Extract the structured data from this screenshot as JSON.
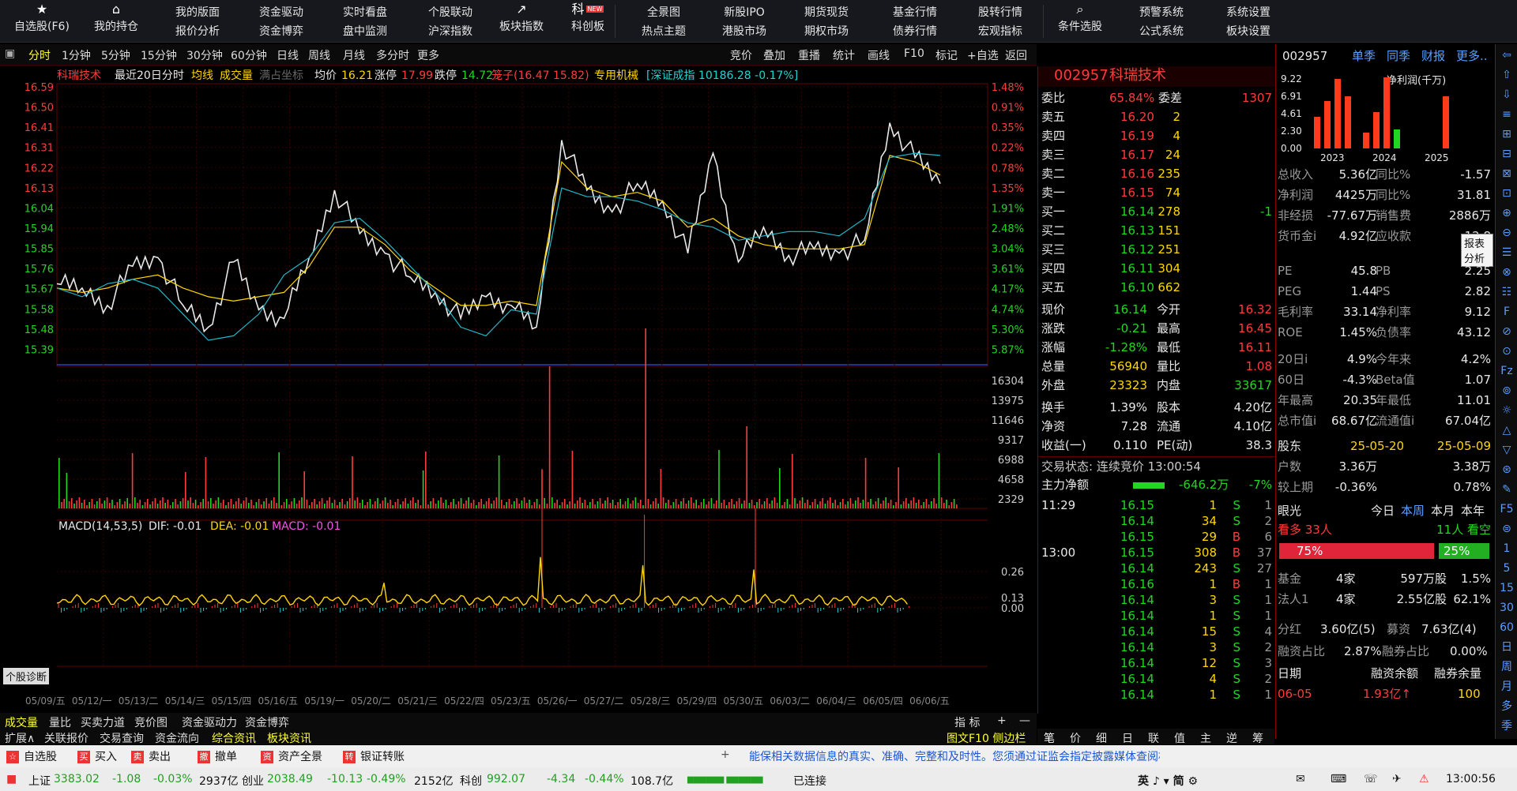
{
  "toolbar": {
    "primary": [
      {
        "icon": "star",
        "label": "自选股(F6)"
      },
      {
        "icon": "home",
        "label": "我的持仓"
      }
    ],
    "pairs": [
      [
        "我的版面",
        "报价分析"
      ],
      [
        "资金驱动",
        "资金博弈"
      ],
      [
        "实时看盘",
        "盘中监测"
      ],
      [
        "个股联动",
        "沪深指数"
      ]
    ],
    "icons2": [
      {
        "icon": "chart",
        "label": "板块指数"
      },
      {
        "icon": "ke",
        "label": "科创板",
        "badge": "NEW"
      }
    ],
    "pairs2": [
      [
        "全景图",
        "热点主题"
      ],
      [
        "新股IPO",
        "港股市场"
      ],
      [
        "期货现货",
        "期权市场"
      ],
      [
        "基金行情",
        "债券行情"
      ],
      [
        "股转行情",
        "宏观指标"
      ]
    ],
    "search": {
      "label": "条件选股"
    },
    "pairs3": [
      [
        "预警系统",
        "公式系统"
      ],
      [
        "系统设置",
        "板块设置"
      ]
    ]
  },
  "tabs": [
    "分时",
    "1分钟",
    "5分钟",
    "15分钟",
    "30分钟",
    "60分钟",
    "日线",
    "周线",
    "月线",
    "多分时",
    "更多"
  ],
  "tab_buttons": [
    "竞价",
    "叠加",
    "重播",
    "统计",
    "画线",
    "F10",
    "标记",
    "+自选",
    "返回"
  ],
  "chart_header": {
    "name": "科瑞技术",
    "desc": "最近20日分时",
    "avg": "均线",
    "vol": "成交量",
    "coord": "满占坐标",
    "avgp_label": "均价",
    "avgp": "16.21",
    "zt_label": "涨停",
    "zt": "17.99",
    "dt_label": "跌停",
    "dt": "14.72",
    "cage": "笼子(16.47 15.82)",
    "industry": "专用机械",
    "index": "[深证成指 10186.28 -0.17%]"
  },
  "chart_data": {
    "type": "line",
    "title": "科瑞技术 最近20日分时",
    "price_ticks": [
      "16.59",
      "16.50",
      "16.41",
      "16.31",
      "16.22",
      "16.13",
      "16.04",
      "15.94",
      "15.85",
      "15.76",
      "15.67",
      "15.58",
      "15.48",
      "15.39"
    ],
    "pct_ticks": [
      "1.48%",
      "0.91%",
      "0.35%",
      "0.22%",
      "0.78%",
      "1.35%",
      "1.91%",
      "2.48%",
      "3.04%",
      "3.61%",
      "4.17%",
      "4.74%",
      "5.30%",
      "5.87%"
    ],
    "vol_ticks": [
      "16304",
      "13975",
      "11646",
      "9317",
      "6988",
      "4658",
      "2329"
    ],
    "macd_ticks": [
      "0.26",
      "0.13",
      "0.00"
    ],
    "dates": [
      "05/09/五",
      "05/12/一",
      "05/13/二",
      "05/14/三",
      "05/15/四",
      "05/16/五",
      "05/19/一",
      "05/20/二",
      "05/21/三",
      "05/22/四",
      "05/23/五",
      "05/26/一",
      "05/27/二",
      "05/28/三",
      "05/29/四",
      "05/30/五",
      "06/03/二",
      "06/04/三",
      "06/05/四",
      "06/06/五"
    ],
    "ylim": [
      15.34,
      16.64
    ],
    "series": [
      {
        "name": "价格",
        "values": [
          15.72,
          15.7,
          15.62,
          15.8,
          15.84,
          15.62,
          15.52,
          15.82,
          15.6,
          15.56,
          15.84,
          16.15,
          15.95,
          15.86,
          15.75,
          15.68,
          15.56,
          15.66,
          15.62,
          15.52,
          16.38,
          16.15,
          16.05,
          16.18,
          16.1,
          15.86,
          16.32,
          15.82,
          15.98,
          15.85,
          15.88,
          15.86,
          15.92,
          16.46,
          16.3,
          16.18
        ]
      },
      {
        "name": "均线",
        "values": [
          15.7,
          15.68,
          15.7,
          15.74,
          15.76,
          15.7,
          15.66,
          15.64,
          15.66,
          15.68,
          15.8,
          15.98,
          15.98,
          15.9,
          15.78,
          15.7,
          15.62,
          15.62,
          15.64,
          15.62,
          16.28,
          16.16,
          16.12,
          16.14,
          16.1,
          15.98,
          16.02,
          15.94,
          15.9,
          15.88,
          15.88,
          15.88,
          15.9,
          16.31,
          16.28,
          16.22
        ]
      },
      {
        "name": "指数",
        "values": [
          15.7,
          15.66,
          15.72,
          15.74,
          15.7,
          15.58,
          15.46,
          15.48,
          15.58,
          15.76,
          15.84,
          16.0,
          16.02,
          15.92,
          15.8,
          15.68,
          15.52,
          15.48,
          15.6,
          15.58,
          16.16,
          16.12,
          16.12,
          16.1,
          16.06,
          16.0,
          15.98,
          15.92,
          15.94,
          15.96,
          15.96,
          15.94,
          16.02,
          16.3,
          16.32,
          16.31
        ]
      }
    ],
    "macd": {
      "dif": "-0.01",
      "dea": "-0.01",
      "macd": "-0.01",
      "name": "MACD(14,53,5)"
    }
  },
  "quote": {
    "code": "002957",
    "name": "科瑞技术",
    "weibi_label": "委比",
    "weibi": "65.84%",
    "weicha_label": "委差",
    "weicha": "1307",
    "asks": [
      {
        "l": "卖五",
        "p": "16.20",
        "v": "2"
      },
      {
        "l": "卖四",
        "p": "16.19",
        "v": "4"
      },
      {
        "l": "卖三",
        "p": "16.17",
        "v": "24"
      },
      {
        "l": "卖二",
        "p": "16.16",
        "v": "235"
      },
      {
        "l": "卖一",
        "p": "16.15",
        "v": "74"
      }
    ],
    "bids": [
      {
        "l": "买一",
        "p": "16.14",
        "v": "278",
        "d": "-1"
      },
      {
        "l": "买二",
        "p": "16.13",
        "v": "151"
      },
      {
        "l": "买三",
        "p": "16.12",
        "v": "251"
      },
      {
        "l": "买四",
        "p": "16.11",
        "v": "304"
      },
      {
        "l": "买五",
        "p": "16.10",
        "v": "662"
      }
    ],
    "stats": [
      [
        "现价",
        "16.14",
        "今开",
        "16.32"
      ],
      [
        "涨跌",
        "-0.21",
        "最高",
        "16.45"
      ],
      [
        "涨幅",
        "-1.28%",
        "最低",
        "16.11"
      ],
      [
        "总量",
        "56940",
        "量比",
        "1.08"
      ],
      [
        "外盘",
        "23323",
        "内盘",
        "33617"
      ]
    ],
    "stats2": [
      [
        "换手",
        "1.39%",
        "股本",
        "4.20亿"
      ],
      [
        "净资",
        "7.28",
        "流通",
        "4.10亿"
      ],
      [
        "收益(一)",
        "0.110",
        "PE(动)",
        "38.3"
      ]
    ],
    "trade_state": "交易状态: 连续竞价 13:00:54",
    "flow_label": "主力净额",
    "flow": "-646.2万",
    "flow_pct": "-7%",
    "ticks": [
      {
        "t": "11:29",
        "p": "16.15",
        "v": "1",
        "s": "S",
        "n": "1"
      },
      {
        "t": "",
        "p": "16.14",
        "v": "34",
        "s": "S",
        "n": "2"
      },
      {
        "t": "",
        "p": "16.15",
        "v": "29",
        "s": "B",
        "n": "6"
      },
      {
        "t": "13:00",
        "p": "16.15",
        "v": "308",
        "s": "B",
        "n": "37"
      },
      {
        "t": "",
        "p": "16.14",
        "v": "243",
        "s": "S",
        "n": "27"
      },
      {
        "t": "",
        "p": "16.16",
        "v": "1",
        "s": "B",
        "n": "1"
      },
      {
        "t": "",
        "p": "16.14",
        "v": "3",
        "s": "S",
        "n": "1"
      },
      {
        "t": "",
        "p": "16.14",
        "v": "1",
        "s": "S",
        "n": "1"
      },
      {
        "t": "",
        "p": "16.14",
        "v": "15",
        "s": "S",
        "n": "4"
      },
      {
        "t": "",
        "p": "16.14",
        "v": "3",
        "s": "S",
        "n": "2"
      },
      {
        "t": "",
        "p": "16.14",
        "v": "12",
        "s": "S",
        "n": "3"
      },
      {
        "t": "",
        "p": "16.14",
        "v": "4",
        "s": "S",
        "n": "2"
      },
      {
        "t": "",
        "p": "16.14",
        "v": "1",
        "s": "S",
        "n": "1"
      }
    ],
    "tabs": [
      "笔",
      "价",
      "细",
      "日",
      "联",
      "值",
      "主",
      "逆",
      "筹"
    ]
  },
  "fin": {
    "code": "002957",
    "tabs": [
      "单季",
      "同季",
      "财报",
      "更多.."
    ],
    "mini_chart": {
      "type": "bar",
      "title": "净利润(千万)",
      "yticks": [
        "9.22",
        "6.91",
        "4.61",
        "2.30",
        "0.00"
      ],
      "years": [
        "2023",
        "2024",
        "2025"
      ],
      "values": [
        4.0,
        6.0,
        8.8,
        6.6,
        2.0,
        4.6,
        9.0,
        2.4,
        0,
        0,
        0,
        6.6
      ],
      "highlight": 7
    },
    "rows": [
      [
        "总收入",
        "5.36亿",
        "同比%",
        "-1.57"
      ],
      [
        "净利润",
        "4425万",
        "同比%",
        "31.81"
      ],
      [
        "非经损",
        "-77.67万",
        "销售费",
        "2886万"
      ],
      [
        "货币金i",
        "4.92亿",
        "应收款",
        "12.8"
      ]
    ],
    "tooltip": "报表分析",
    "val": [
      [
        "PE",
        "45.8",
        "PB",
        "2.25"
      ],
      [
        "PEG",
        "1.44",
        "PS",
        "2.82"
      ],
      [
        "毛利率",
        "33.14",
        "净利率",
        "9.12"
      ],
      [
        "ROE",
        "1.45%",
        "负债率",
        "43.12"
      ]
    ],
    "perf": [
      [
        "20日i",
        "4.9%",
        "今年来",
        "4.2%"
      ],
      [
        "60日",
        "-4.3%",
        "Beta值",
        "1.07"
      ],
      [
        "年最高",
        "20.35",
        "年最低",
        "11.01"
      ],
      [
        "总市值i",
        "68.67亿",
        "流通值i",
        "67.04亿"
      ]
    ],
    "holders": {
      "label": "股东",
      "d1": "25-05-20",
      "d2": "25-05-09",
      "rows": [
        [
          "户数",
          "3.36万",
          "3.38万"
        ],
        [
          "较上期",
          "-0.36%",
          "0.78%"
        ]
      ]
    },
    "eye": {
      "label": "眼光",
      "tabs": [
        "今日",
        "本周",
        "本月",
        "本年"
      ],
      "bull": "看多 33人",
      "bear": "11人 看空",
      "bull_pct": "75%",
      "bear_pct": "25%"
    },
    "inst": [
      [
        "基金",
        "4家",
        "597万股",
        "1.5%"
      ],
      [
        "法人1",
        "4家",
        "2.55亿股",
        "62.1%"
      ]
    ],
    "fenhong": [
      "分红",
      "3.60亿(5)",
      "募资",
      "7.63亿(4)"
    ],
    "margin": [
      "融资占比",
      "2.87%",
      "融券占比",
      "0.00%"
    ],
    "mtable": {
      "h": [
        "日期",
        "融资余额",
        "融券余量"
      ],
      "r": [
        "06-05",
        "1.93亿↑",
        "100"
      ]
    }
  },
  "bottom_tabs": [
    "成交量",
    "量比",
    "买卖力道",
    "竞价图",
    "资金驱动力",
    "资金博弈"
  ],
  "bottom_right": [
    "指 标",
    "+",
    "—"
  ],
  "bottom_tabs2": [
    "扩展∧",
    "关联报价",
    "交易查询",
    "资金流向",
    "综合资讯",
    "板块资讯"
  ],
  "bottom_tabs2_right": "图文F10 侧边栏",
  "diag": "个股诊断",
  "actions": [
    {
      "icon": "☆",
      "label": "自选股"
    },
    {
      "icon": "买",
      "label": "买入"
    },
    {
      "icon": "卖",
      "label": "卖出"
    },
    {
      "icon": "撤",
      "label": "撤单"
    },
    {
      "icon": "资",
      "label": "资产全景"
    },
    {
      "icon": "转",
      "label": "银证转账"
    }
  ],
  "notice": "能保相关数据信息的真实、准确、完整和及时性。您须通过证监会指定披露媒体查阅相关信息，并自担投资风险。",
  "status": {
    "sh_label": "上证",
    "sh": "3383.02",
    "sh_ch": "-1.08",
    "sh_pct": "-0.03%",
    "sh_amt": "2937亿",
    "cy_label": "创业",
    "cy": "2038.49",
    "cy_ch": "-10.13",
    "cy_pct": "-0.49%",
    "cy_amt": "2152亿",
    "kc_label": "科创",
    "kc": "992.07",
    "kc_ch": "-4.34",
    "kc_pct": "-0.44%",
    "kc_amt": "108.7亿",
    "conn": "已连接",
    "ime": "英 ♪ ▾ 简 ⚙",
    "time": "13:00:56"
  },
  "rightbar_icons": [
    "⇦",
    "⇧",
    "⇩",
    "≡",
    "⊞",
    "⊟",
    "⊠",
    "⊡",
    "⊕",
    "⊖",
    "☰",
    "⊗",
    "☷",
    "F",
    "⊘",
    "⊙",
    "Fz",
    "⊚",
    "☼",
    "△",
    "▽",
    "⊛",
    "✎",
    "F5",
    "⊜",
    "1",
    "5",
    "15",
    "30",
    "60",
    "日",
    "周",
    "月",
    "多",
    "季"
  ]
}
